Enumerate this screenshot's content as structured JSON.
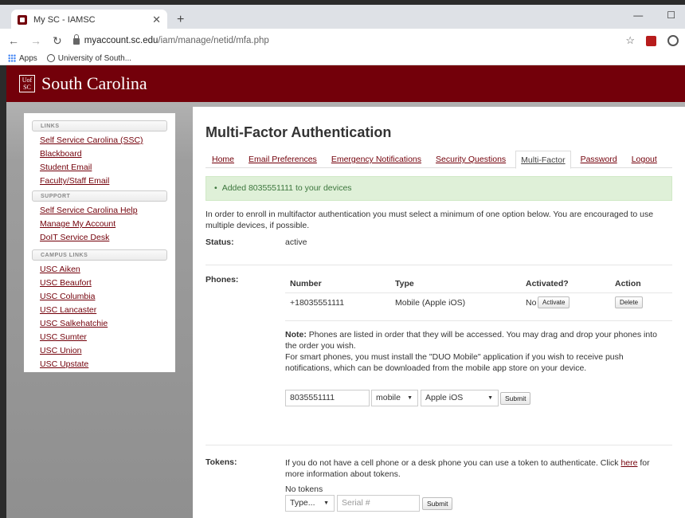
{
  "browser": {
    "tab_title": "My SC - IAMSC",
    "url_host": "myaccount.sc.edu",
    "url_path": "/iam/manage/netid/mfa.php",
    "bookmarks": [
      "Apps",
      "University of South..."
    ]
  },
  "header": {
    "logo_line1": "Uof",
    "logo_line2": "SC",
    "site_name": "South Carolina"
  },
  "sidebar": {
    "sections": [
      {
        "heading": "LINKS",
        "links": [
          "Self Service Carolina (SSC)",
          "Blackboard",
          "Student Email",
          "Faculty/Staff Email"
        ]
      },
      {
        "heading": "SUPPORT",
        "links": [
          "Self Service Carolina Help",
          "Manage My Account",
          "DoIT Service Desk"
        ]
      },
      {
        "heading": "CAMPUS LINKS",
        "links": [
          "USC Aiken",
          "USC Beaufort",
          "USC Columbia",
          "USC Lancaster",
          "USC Salkehatchie",
          "USC Sumter",
          "USC Union",
          "USC Upstate"
        ]
      }
    ]
  },
  "main": {
    "title": "Multi-Factor Authentication",
    "tabs": [
      "Home",
      "Email Preferences",
      "Emergency Notifications",
      "Security Questions",
      "Multi-Factor",
      "Password",
      "Logout"
    ],
    "active_tab": "Multi-Factor",
    "alert": "Added 8035551111 to your devices",
    "intro": "In order to enroll in multifactor authentication you must select a minimum of one option below. You are encouraged to use multiple devices, if possible.",
    "status_label": "Status:",
    "status_value": "active",
    "phones_label": "Phones:",
    "phones_headers": [
      "Number",
      "Type",
      "Activated?",
      "Action"
    ],
    "phone_row": {
      "number": "+18035551111",
      "type": "Mobile (Apple iOS)",
      "activated": "No",
      "activate_btn": "Activate",
      "delete_btn": "Delete"
    },
    "note_bold": "Note:",
    "note_text": " Phones are listed in order that they will be accessed. You may drag and drop your phones into the order you wish.",
    "note_text2": "For smart phones, you must install the \"DUO Mobile\" application if you wish to receive push notifications, which can be downloaded from the mobile app store on your device.",
    "phone_input_value": "8035551111",
    "phone_type_select": "mobile",
    "phone_os_select": "Apple iOS",
    "submit_label": "Submit",
    "tokens_label": "Tokens:",
    "tokens_text_before": "If you do not have a cell phone or a desk phone you can use a token to authenticate. Click ",
    "tokens_link": "here",
    "tokens_text_after": " for more information about tokens.",
    "no_tokens": "No tokens",
    "token_type_select": "Type...",
    "serial_placeholder": "Serial #",
    "token_submit_label": "Submit"
  }
}
